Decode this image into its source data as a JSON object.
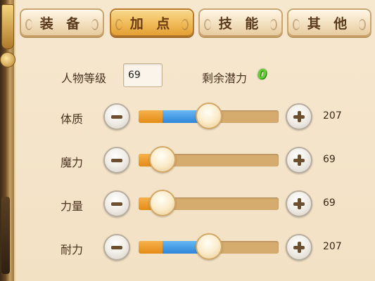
{
  "tabs": [
    {
      "label": "装 备",
      "active": false
    },
    {
      "label": "加 点",
      "active": true
    },
    {
      "label": "技 能",
      "active": false
    },
    {
      "label": "其 他",
      "active": false
    }
  ],
  "level": {
    "label": "人物等级",
    "value": "69"
  },
  "remaining": {
    "label": "剩余潜力",
    "value": "0"
  },
  "stats": [
    {
      "label": "体质",
      "value": "207",
      "base_fraction": 0.17,
      "blue_fraction": 0.5,
      "knob_fraction": 0.5
    },
    {
      "label": "魔力",
      "value": "69",
      "base_fraction": 0.17,
      "blue_fraction": 0.0,
      "knob_fraction": 0.17
    },
    {
      "label": "力量",
      "value": "69",
      "base_fraction": 0.17,
      "blue_fraction": 0.0,
      "knob_fraction": 0.17
    },
    {
      "label": "耐力",
      "value": "207",
      "base_fraction": 0.17,
      "blue_fraction": 0.5,
      "knob_fraction": 0.5
    }
  ],
  "colors": {
    "accent_tab": "#f0bb58",
    "fill_orange": "#e58b17",
    "fill_blue": "#2f86d8",
    "remaining_green": "#5ed12c"
  },
  "icons": {
    "minus": "minus-icon",
    "plus": "plus-icon"
  }
}
